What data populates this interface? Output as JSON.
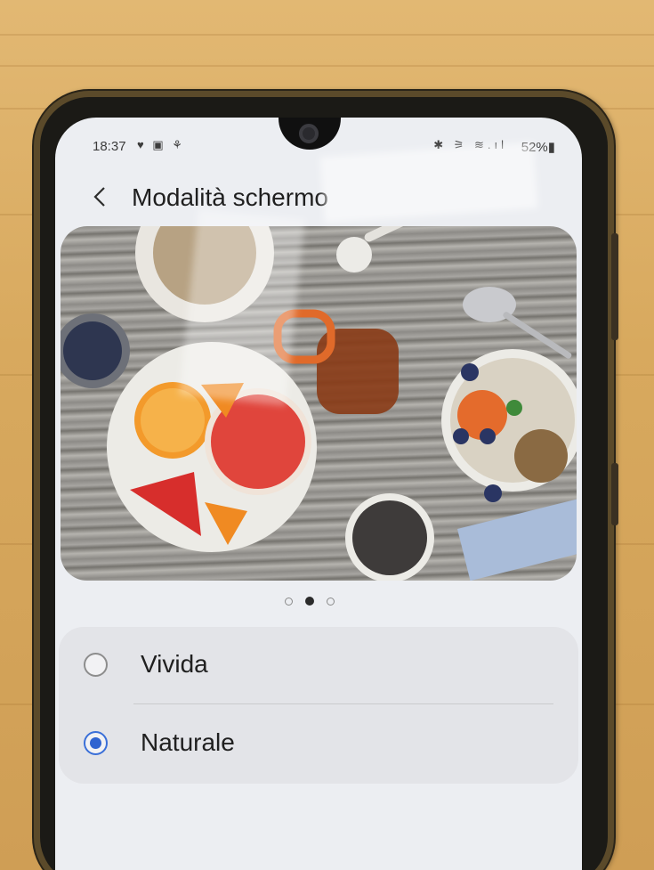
{
  "status_bar": {
    "time": "18:37",
    "left_icons": "♥ ▣ ⚘",
    "right_icons": "✱ ⚞ ≋.ıl",
    "battery": "52%▮"
  },
  "header": {
    "title": "Modalità schermo"
  },
  "pager": {
    "count": 3,
    "active_index": 1
  },
  "options": [
    {
      "label": "Vivida",
      "selected": false
    },
    {
      "label": "Naturale",
      "selected": true
    }
  ],
  "colors": {
    "accent": "#2f63d0",
    "screen_background": "#eceef2",
    "card_background": "#e3e4e8"
  }
}
